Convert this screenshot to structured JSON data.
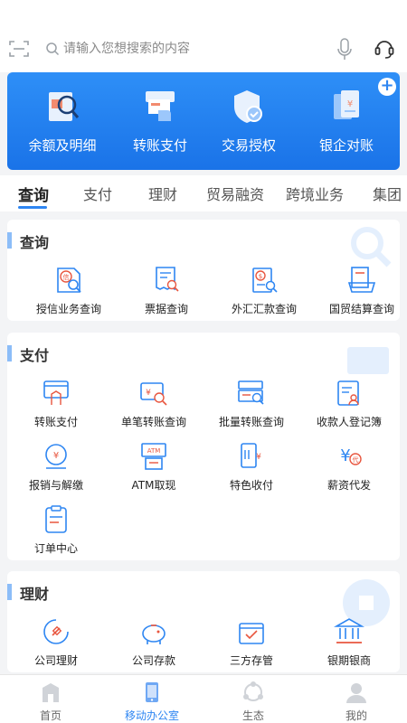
{
  "search": {
    "placeholder": "请输入您想搜索的内容"
  },
  "banner": {
    "items": [
      {
        "label": "余额及明细",
        "icon": "balance-detail-icon"
      },
      {
        "label": "转账支付",
        "icon": "transfer-pay-icon"
      },
      {
        "label": "交易授权",
        "icon": "transaction-auth-icon"
      },
      {
        "label": "银企对账",
        "icon": "bank-reconcile-icon"
      }
    ]
  },
  "tabs": [
    "查询",
    "支付",
    "理财",
    "贸易融资",
    "跨境业务",
    "集团"
  ],
  "sections": {
    "query": {
      "title": "查询",
      "items": [
        "授信业务查询",
        "票据查询",
        "外汇汇款查询",
        "国贸结算查询"
      ]
    },
    "pay": {
      "title": "支付",
      "items": [
        "转账支付",
        "单笔转账查询",
        "批量转账查询",
        "收款人登记簿",
        "报销与解缴",
        "ATM取现",
        "特色收付",
        "薪资代发",
        "订单中心"
      ]
    },
    "finance": {
      "title": "理财",
      "items": [
        "公司理财",
        "公司存款",
        "三方存管",
        "银期银商"
      ]
    }
  },
  "icon_text": {
    "credit": "信",
    "atm": "ATM",
    "yen": "¥",
    "dai": "代"
  },
  "bottom_nav": [
    {
      "label": "首页",
      "icon": "home-icon"
    },
    {
      "label": "移动办公室",
      "icon": "mobile-office-icon",
      "active": true
    },
    {
      "label": "生态",
      "icon": "ecosystem-icon"
    },
    {
      "label": "我的",
      "icon": "profile-icon"
    }
  ],
  "colors": {
    "accent": "#2e86f2",
    "icon_red": "#e8563f",
    "banner": "#1f7cec"
  }
}
